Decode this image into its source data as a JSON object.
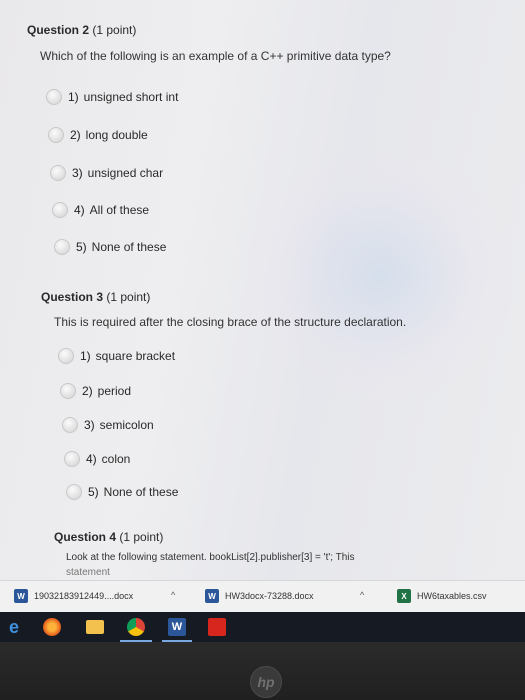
{
  "questions": [
    {
      "title": "Question 2",
      "points": "(1 point)",
      "text": "Which of the following is an example of a C++ primitive data type?",
      "options": [
        {
          "num": "1)",
          "label": "unsigned short int"
        },
        {
          "num": "2)",
          "label": "long double"
        },
        {
          "num": "3)",
          "label": "unsigned char"
        },
        {
          "num": "4)",
          "label": "All of these"
        },
        {
          "num": "5)",
          "label": "None of these"
        }
      ]
    },
    {
      "title": "Question 3",
      "points": "(1 point)",
      "text": "This is required after the closing brace of the structure declaration.",
      "options": [
        {
          "num": "1)",
          "label": "square bracket"
        },
        {
          "num": "2)",
          "label": "period"
        },
        {
          "num": "3)",
          "label": "semicolon"
        },
        {
          "num": "4)",
          "label": "colon"
        },
        {
          "num": "5)",
          "label": "None of these"
        }
      ]
    },
    {
      "title": "Question 4",
      "points": "(1 point)",
      "text": "Look at the following statement. bookList[2].publisher[3] = 't'; This",
      "text2": "statement"
    }
  ],
  "downloads": [
    {
      "name": "19032183912449....docx",
      "icon": "word-file-icon"
    },
    {
      "name": "HW3docx-73288.docx",
      "icon": "word-file-icon"
    },
    {
      "name": "HW6taxables.csv",
      "icon": "excel-file-icon"
    }
  ],
  "taskbar": {
    "icons": [
      "edge-icon",
      "firefox-icon",
      "file-explorer-icon",
      "chrome-icon",
      "word-icon",
      "acrobat-icon"
    ],
    "word_glyph": "W",
    "edge_glyph": "e"
  },
  "bezel": {
    "logo": "hp"
  }
}
